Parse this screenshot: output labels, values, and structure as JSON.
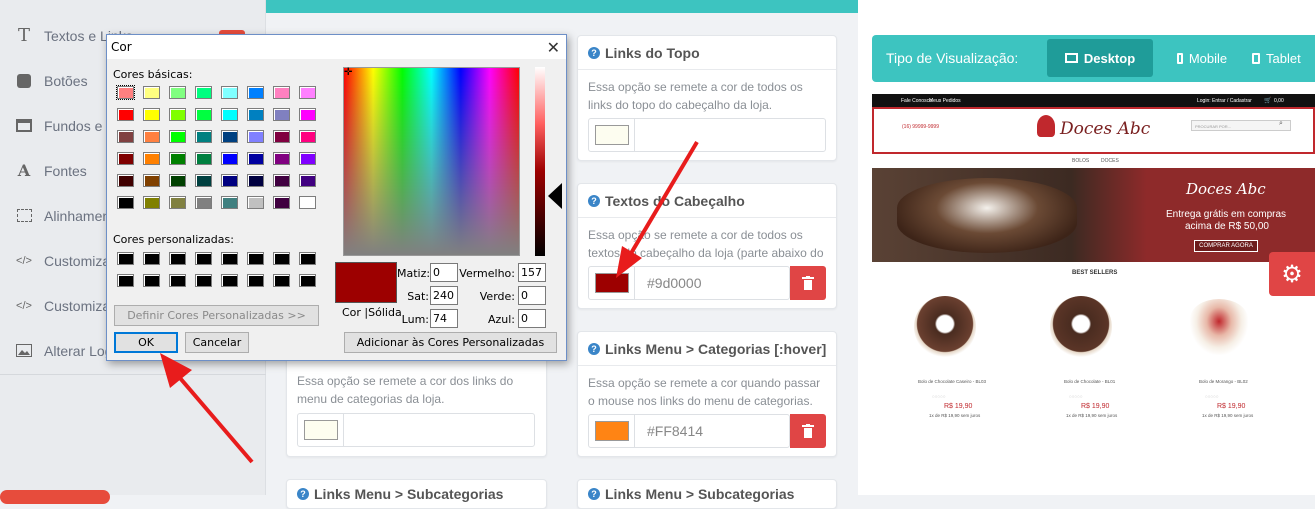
{
  "sidebar": {
    "items": [
      {
        "label": "Textos e Links",
        "icon": "text-icon"
      },
      {
        "label": "Botões",
        "icon": "button-icon"
      },
      {
        "label": "Fundos e Barras",
        "icon": "window-icon"
      },
      {
        "label": "Fontes",
        "icon": "font-icon"
      },
      {
        "label": "Alinhamento",
        "icon": "align-icon"
      },
      {
        "label": "Customizar CSS",
        "icon": "code-icon"
      },
      {
        "label": "Customizar JS",
        "icon": "code-icon"
      },
      {
        "label": "Alterar Logo",
        "icon": "image-icon"
      }
    ]
  },
  "cards": {
    "links_topo": {
      "title": "Links do Topo",
      "desc": "Essa opção se remete a cor de todos os links do topo do cabeçalho da loja.",
      "color": "#fdfdf0"
    },
    "textos_cabecalho": {
      "title": "Textos do Cabeçalho",
      "desc": "Essa opção se remete a cor de todos os textos do cabeçalho da loja (parte abaixo do topo).",
      "value": "#9d0000",
      "color": "#9d0000"
    },
    "links_menu": {
      "desc": "Essa opção se remete a cor dos links do menu de categorias da loja.",
      "color": "#fdfdf0"
    },
    "links_menu_hover": {
      "title": "Links Menu > Categorias [:hover]",
      "desc": "Essa opção se remete a cor quando passar o mouse nos links do menu de categorias.",
      "value": "#FF8414",
      "color": "#FF8414"
    },
    "links_sub_left": {
      "title": "Links Menu > Subcategorias"
    },
    "links_sub_right": {
      "title": "Links Menu > Subcategorias"
    }
  },
  "viewbar": {
    "label": "Tipo de Visualização:",
    "desktop": "Desktop",
    "mobile": "Mobile",
    "tablet": "Tablet"
  },
  "preview": {
    "top_left": [
      "Fale Conosco",
      "Meus Pedidos"
    ],
    "top_right": "Login: Entrar / Cadastrar",
    "cart": "0,00",
    "phone": "(16) 99999-9999",
    "logo": "Doces Abc",
    "search_placeholder": "PROCURAR POR...",
    "menu": [
      "BOLOS",
      "DOCES"
    ],
    "banner_logo": "Doces Abc",
    "banner_line1": "Entrega grátis em compras",
    "banner_line2": "acima de R$ 50,00",
    "banner_button": "COMPRAR AGORA",
    "bestsellers": "BEST SELLERS",
    "products": [
      {
        "name": "Bolo de Chocolate Caseiro - BL03",
        "price": "R$ 19,90",
        "installment": "1x de R$ 19,90 sem juros"
      },
      {
        "name": "Bolo de Chocolate - BL01",
        "price": "R$ 19,90",
        "installment": "1x de R$ 19,90 sem juros"
      },
      {
        "name": "Bolo de Morango - BL02",
        "price": "R$ 19,90",
        "installment": "1x de R$ 19,90 sem juros"
      }
    ]
  },
  "dialog": {
    "title": "Cor",
    "basic_label": "Cores básicas:",
    "custom_label": "Cores personalizadas:",
    "define_button": "Definir Cores Personalizadas >>",
    "ok": "OK",
    "cancel": "Cancelar",
    "solid_label": "Cor  |Sólida",
    "add_button": "Adicionar às Cores Personalizadas",
    "hue_label": "Matiz:",
    "hue": "0",
    "sat_label": "Sat:",
    "sat": "240",
    "lum_label": "Lum:",
    "lum": "74",
    "red_label": "Vermelho:",
    "red": "157",
    "green_label": "Verde:",
    "green": "0",
    "blue_label": "Azul:",
    "blue": "0",
    "current_color": "#9d0000",
    "basic_colors": [
      "#ff8080",
      "#ffff80",
      "#80ff80",
      "#00ff80",
      "#80ffff",
      "#0080ff",
      "#ff80c0",
      "#ff80ff",
      "#ff0000",
      "#ffff00",
      "#80ff00",
      "#00ff40",
      "#00ffff",
      "#0080c0",
      "#8080c0",
      "#ff00ff",
      "#804040",
      "#ff8040",
      "#00ff00",
      "#008080",
      "#004080",
      "#8080ff",
      "#800040",
      "#ff0080",
      "#800000",
      "#ff8000",
      "#008000",
      "#008040",
      "#0000ff",
      "#0000a0",
      "#800080",
      "#8000ff",
      "#400000",
      "#804000",
      "#004000",
      "#004040",
      "#000080",
      "#000040",
      "#400040",
      "#400080",
      "#000000",
      "#808000",
      "#808040",
      "#808080",
      "#408080",
      "#c0c0c0",
      "#400040",
      "#ffffff"
    ]
  }
}
